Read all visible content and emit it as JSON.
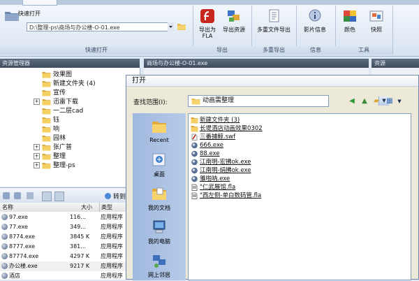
{
  "ribbon": {
    "tab_label": "",
    "quick_open_label": "快速打开",
    "quick_open_path": "D:\\整理-ps\\商场与办公楼-O-01.exe",
    "groups": [
      {
        "title": "快速打开"
      },
      {
        "title": "导出"
      },
      {
        "title": "多重导出"
      },
      {
        "title": "信息"
      },
      {
        "title": "工具"
      }
    ],
    "buttons": {
      "export_flash": "导出为\nFLA",
      "export_resources": "导出资源",
      "multi_file_export": "多重文件导出",
      "movie_info": "影片信息",
      "color": "颜色",
      "shortcuts": "快照"
    }
  },
  "left_pane": {
    "header": "资源管理器",
    "tree_items": [
      {
        "label": "效果图",
        "expander": ""
      },
      {
        "label": "新建文件夹 (4)",
        "expander": ""
      },
      {
        "label": "宣传",
        "expander": ""
      },
      {
        "label": "迅雷下载",
        "expander": "+"
      },
      {
        "label": "一二层cad",
        "expander": ""
      },
      {
        "label": "钰",
        "expander": ""
      },
      {
        "label": "响",
        "expander": ""
      },
      {
        "label": "园林",
        "expander": ""
      },
      {
        "label": "张广普",
        "expander": "+"
      },
      {
        "label": "整理",
        "expander": "+"
      },
      {
        "label": "整理-ps",
        "expander": "+"
      }
    ]
  },
  "middle_pane": {
    "header": "商场与办公楼-O-01.exe"
  },
  "right_pane": {
    "header": "资源"
  },
  "file_list": {
    "toolbar_label": "转到",
    "columns": {
      "name": "名称",
      "size": "大小",
      "type": "类型"
    },
    "rows": [
      {
        "name": "97.exe",
        "size": "116...",
        "type": "应用程序"
      },
      {
        "name": "77.exe",
        "size": "349...",
        "type": "应用程序"
      },
      {
        "name": "8774.exe",
        "size": "3845 K",
        "type": "应用程序"
      },
      {
        "name": "8777.exe",
        "size": "381...",
        "type": "应用程序"
      },
      {
        "name": "87774.exe",
        "size": "4297 K",
        "type": "应用程序"
      },
      {
        "name": "办公楼.exe",
        "size": "9217 K",
        "type": "应用程序"
      },
      {
        "name": "酒店",
        "size": "",
        "type": "应用程序"
      }
    ]
  },
  "dialog": {
    "title": "打开",
    "look_in_label": "查找范围(I):",
    "look_in_value": "动画需整理",
    "places": [
      {
        "label": "Recent"
      },
      {
        "label": "桌面"
      },
      {
        "label": "我的文档"
      },
      {
        "label": "我的电脑"
      },
      {
        "label": "网上邻居"
      }
    ],
    "files": [
      {
        "name": "新建文件夹 (3)",
        "kind": "folder"
      },
      {
        "name": "长堤酒店动画效果0302",
        "kind": "folder"
      },
      {
        "name": "三番捕鲸.swf",
        "kind": "swf"
      },
      {
        "name": "666.exe",
        "kind": "exe"
      },
      {
        "name": "88.exe",
        "kind": "exe"
      },
      {
        "name": "江南明-宏拂ok.exe",
        "kind": "exe"
      },
      {
        "name": "江南明-绢拂ok.exe",
        "kind": "exe"
      },
      {
        "name": "雏啪呐.exe",
        "kind": "exe"
      },
      {
        "name": "\"仁武展馆.fla",
        "kind": "fla"
      },
      {
        "name": "\"西左侧-单白数码管.fla",
        "kind": "fla"
      }
    ]
  },
  "colors": {
    "titlebar": "#4b586b",
    "ribbon_bg": "#e9eff8",
    "places_bar": "#a7bfe2",
    "dialog_bg": "#ece9d8"
  }
}
